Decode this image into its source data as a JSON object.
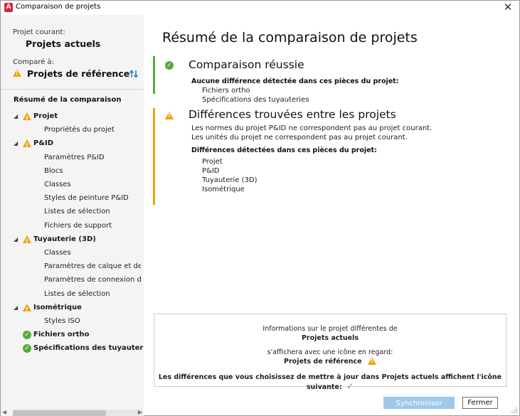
{
  "window": {
    "title": "Comparaison de projets",
    "app_icon_letter": "A",
    "close_glyph": "✕"
  },
  "left": {
    "current_project_label": "Projet courant:",
    "current_project_name": "Projets actuels",
    "compared_label": "Comparé à:",
    "compared_project_name": "Projets de référence",
    "tree_heading": "Résumé de la comparaison",
    "tree": [
      {
        "label": "Projet",
        "status": "warning",
        "expanded": true,
        "children": [
          "Propriétés du projet"
        ]
      },
      {
        "label": "P&ID",
        "status": "warning",
        "expanded": true,
        "children": [
          "Paramètres P&ID",
          "Blocs",
          "Classes",
          "Styles de peinture P&ID",
          "Listes de sélection",
          "Fichiers de support"
        ]
      },
      {
        "label": "Tuyauterie (3D)",
        "status": "warning",
        "expanded": true,
        "children": [
          "Classes",
          "Paramètres de calque et de cc",
          "Paramètres de connexion de l",
          "Listes de sélection"
        ]
      },
      {
        "label": "Isométrique",
        "status": "warning",
        "expanded": true,
        "children": [
          "Styles ISO"
        ]
      },
      {
        "label": "Fichiers ortho",
        "status": "ok",
        "expanded": false,
        "children": []
      },
      {
        "label": "Spécifications des tuyauteries",
        "status": "ok",
        "expanded": false,
        "children": []
      }
    ]
  },
  "main": {
    "title": "Résumé de la comparaison de projets",
    "success": {
      "title": "Comparaison réussie",
      "subtitle": "Aucune différence détectée dans ces pièces du projet:",
      "items": [
        "Fichiers ortho",
        "Spécifications des tuyauteries"
      ]
    },
    "differences": {
      "title": "Différences trouvées entre les projets",
      "notes": [
        "Les normes du projet P&ID ne correspondent pas au projet courant.",
        "Les unités du projet ne correspondent pas au projet courant."
      ],
      "subtitle": "Différences détectées dans ces pièces du projet:",
      "items": [
        "Projet",
        "P&ID",
        "Tuyauterie (3D)",
        "Isométrique"
      ]
    },
    "info": {
      "line1": "Informations sur le projet différentes de",
      "project_current": "Projets actuels",
      "line2": "s'affichera avec une icône en regard:",
      "project_ref": "Projets de référence",
      "line3": "Les différences que vous choisissez de mettre à jour dans Projets actuels affichent l'icône suivante:"
    }
  },
  "buttons": {
    "sync": "Synchroniser",
    "close": "Fermer"
  },
  "colors": {
    "ok_green": "#59a93c",
    "warning_orange": "#f0a30a",
    "sync_disabled_blue": "#9ec9eb"
  }
}
